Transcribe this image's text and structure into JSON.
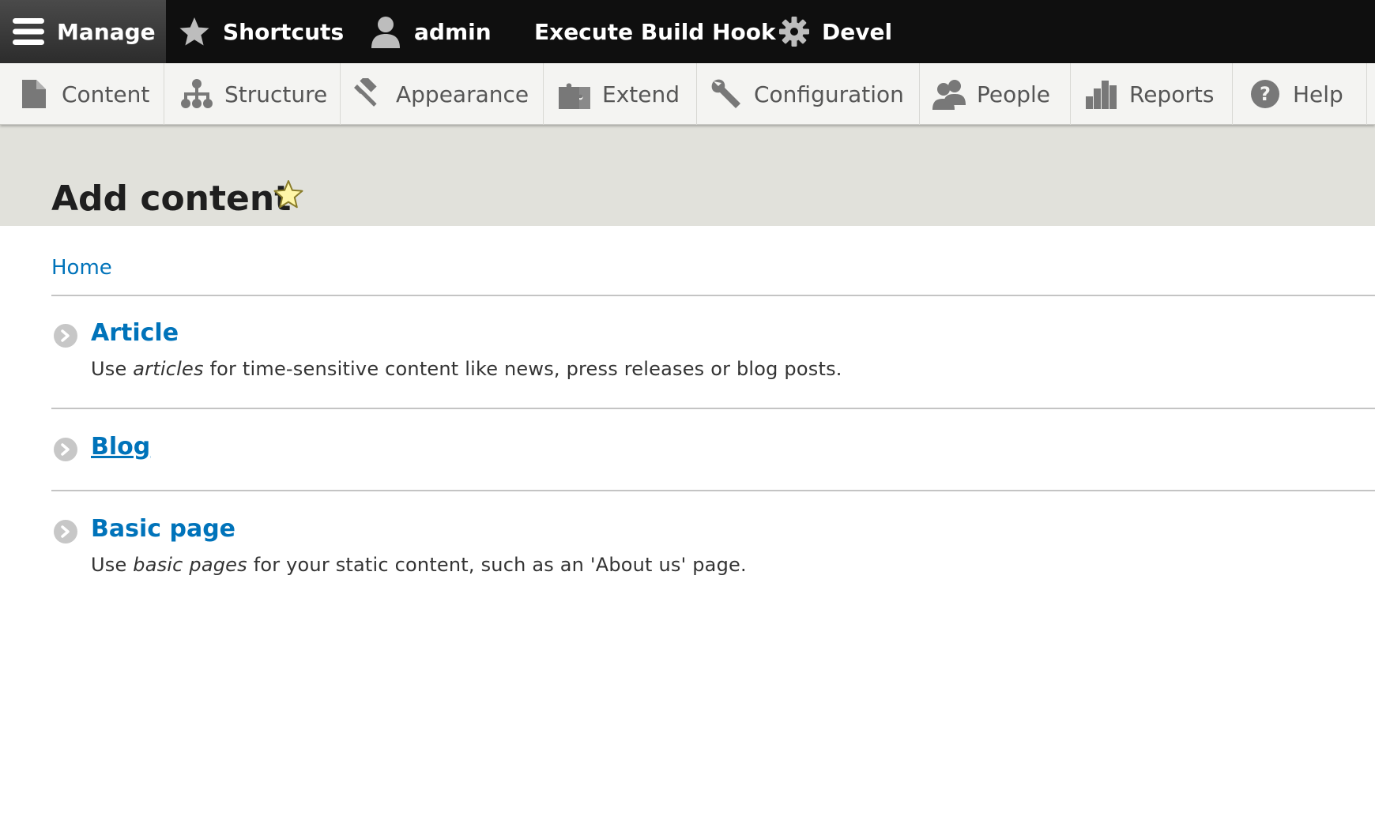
{
  "toolbar": {
    "manage": "Manage",
    "shortcuts": "Shortcuts",
    "user": "admin",
    "build_hook": "Execute Build Hook",
    "devel": "Devel"
  },
  "tray": {
    "items": [
      {
        "label": "Content",
        "icon": "file-icon"
      },
      {
        "label": "Structure",
        "icon": "sitemap-icon"
      },
      {
        "label": "Appearance",
        "icon": "paint-roller-icon"
      },
      {
        "label": "Extend",
        "icon": "puzzle-icon"
      },
      {
        "label": "Configuration",
        "icon": "wrench-icon"
      },
      {
        "label": "People",
        "icon": "people-icon"
      },
      {
        "label": "Reports",
        "icon": "bar-chart-icon"
      },
      {
        "label": "Help",
        "icon": "help-icon"
      }
    ]
  },
  "page": {
    "title": "Add content",
    "breadcrumb": "Home"
  },
  "content_types": [
    {
      "name": "Article",
      "desc_prefix": "Use ",
      "desc_em": "articles",
      "desc_suffix": " for time-sensitive content like news, press releases or blog posts."
    },
    {
      "name": "Blog"
    },
    {
      "name": "Basic page",
      "desc_prefix": "Use ",
      "desc_em": "basic pages",
      "desc_suffix": " for your static content, such as an 'About us' page."
    }
  ],
  "colors": {
    "toolbar_bg": "#0f0f0f",
    "tray_bg": "#f4f4f2",
    "header_bg": "#e1e1db",
    "link": "#0073ba",
    "star": "#fff6a8"
  }
}
